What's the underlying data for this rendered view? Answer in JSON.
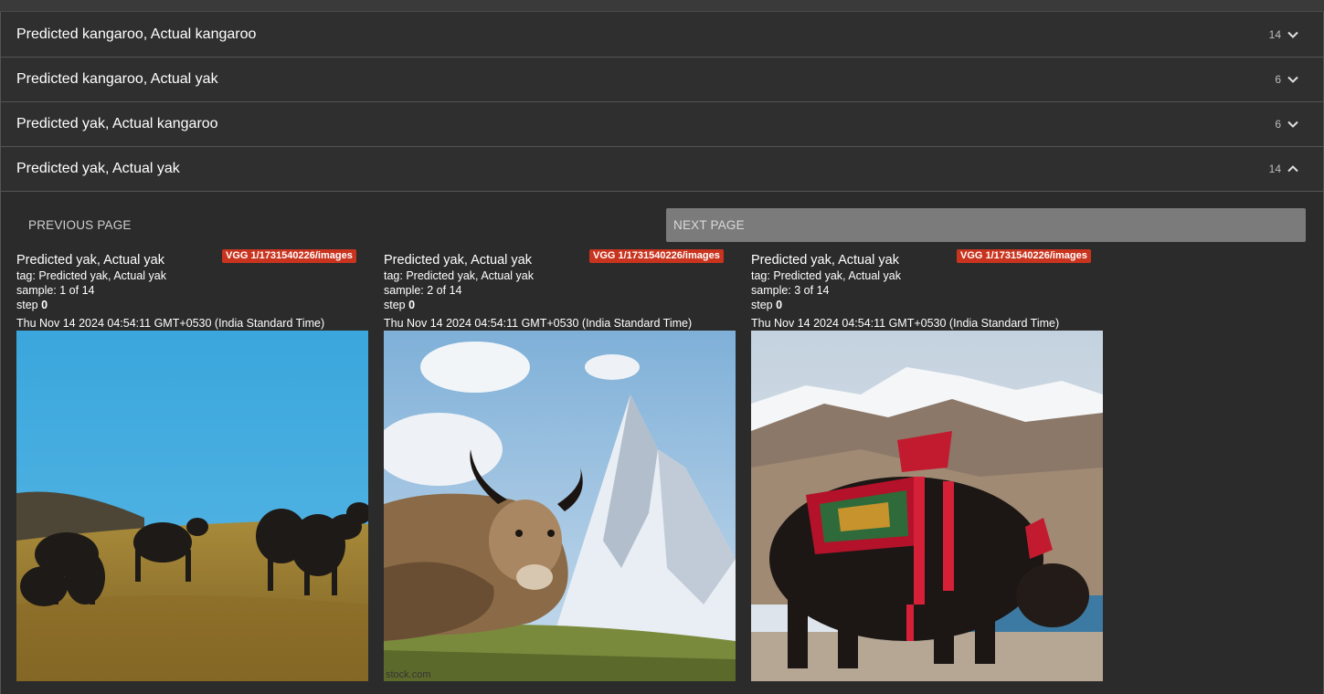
{
  "groups": [
    {
      "title": "Predicted kangaroo, Actual kangaroo",
      "count": "14",
      "expanded": false
    },
    {
      "title": "Predicted kangaroo, Actual yak",
      "count": "6",
      "expanded": false
    },
    {
      "title": "Predicted yak, Actual kangaroo",
      "count": "6",
      "expanded": false
    },
    {
      "title": "Predicted yak, Actual yak",
      "count": "14",
      "expanded": true
    }
  ],
  "pager": {
    "previous_label": "PREVIOUS PAGE",
    "next_label": "NEXT PAGE"
  },
  "cards": [
    {
      "title": "Predicted yak, Actual yak",
      "run_badge": "VGG 1/1731540226/images",
      "tag_label": "tag: ",
      "tag": "Predicted yak, Actual yak",
      "sample_label": "sample: ",
      "sample": "1 of 14",
      "step_label": "step ",
      "step": "0",
      "date": "Thu Nov 14 2024 04:54:11 GMT+0530 (India Standard Time)"
    },
    {
      "title": "Predicted yak, Actual yak",
      "run_badge": "VGG 1/1731540226/images",
      "tag_label": "tag: ",
      "tag": "Predicted yak, Actual yak",
      "sample_label": "sample: ",
      "sample": "2 of 14",
      "step_label": "step ",
      "step": "0",
      "date": "Thu Nov 14 2024 04:54:11 GMT+0530 (India Standard Time)",
      "watermark": "stock.com"
    },
    {
      "title": "Predicted yak, Actual yak",
      "run_badge": "VGG 1/1731540226/images",
      "tag_label": "tag: ",
      "tag": "Predicted yak, Actual yak",
      "sample_label": "sample: ",
      "sample": "3 of 14",
      "step_label": "step ",
      "step": "0",
      "date": "Thu Nov 14 2024 04:54:11 GMT+0530 (India Standard Time)"
    }
  ],
  "colors": {
    "badge": "#c9341f",
    "next_button": "#7b7b7b",
    "background": "#2b2b2b"
  }
}
